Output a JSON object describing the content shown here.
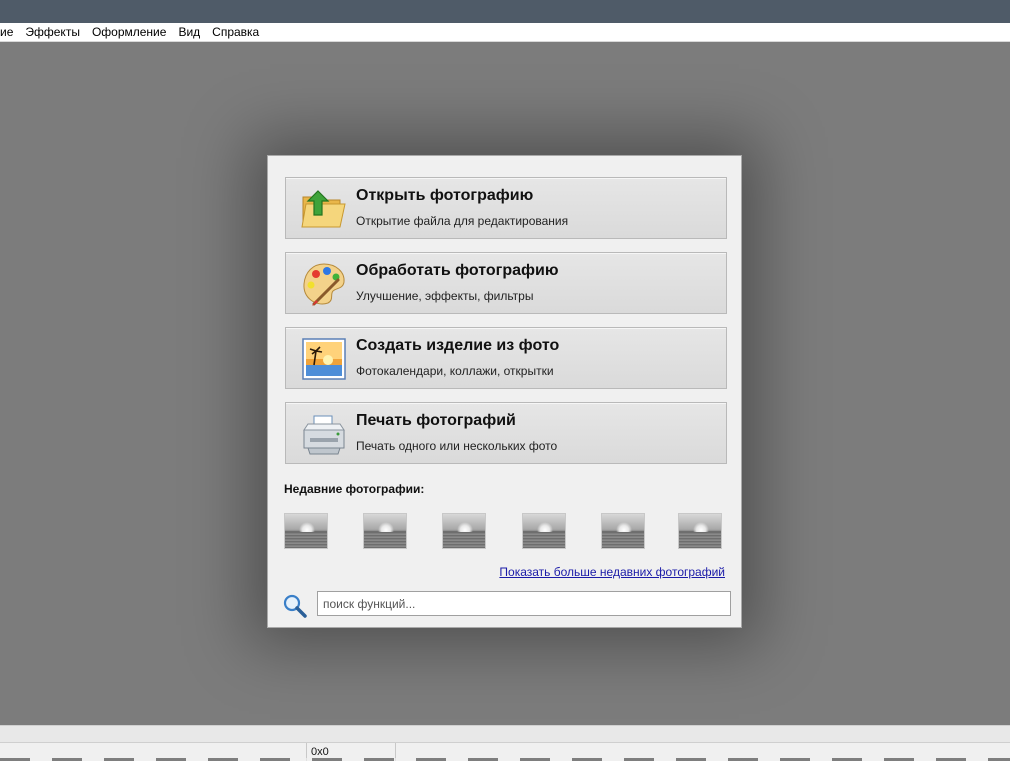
{
  "menu": {
    "items": [
      {
        "label": "ие"
      },
      {
        "label": "Эффекты"
      },
      {
        "label": "Оформление"
      },
      {
        "label": "Вид"
      },
      {
        "label": "Справка"
      }
    ]
  },
  "panel": {
    "actions": [
      {
        "title": "Открыть фотографию",
        "subtitle": "Открытие файла для редактирования",
        "icon": "open-folder-icon"
      },
      {
        "title": "Обработать фотографию",
        "subtitle": "Улучшение, эффекты, фильтры",
        "icon": "palette-icon"
      },
      {
        "title": "Создать изделие из фото",
        "subtitle": "Фотокалендари, коллажи, открытки",
        "icon": "photo-product-icon"
      },
      {
        "title": "Печать фотографий",
        "subtitle": "Печать одного или нескольких фото",
        "icon": "printer-icon"
      }
    ],
    "recent_label": "Недавние фотографии:",
    "recent_count": 6,
    "more_link": "Показать больше недавних фотографий",
    "search": {
      "placeholder": "поиск функций...",
      "value": ""
    }
  },
  "status": {
    "size": "0x0"
  },
  "colors": {
    "titlebar": "#4f5b68",
    "workspace": "#7c7c7c",
    "panel": "#f0f0f0",
    "link": "#1a1aa8"
  }
}
